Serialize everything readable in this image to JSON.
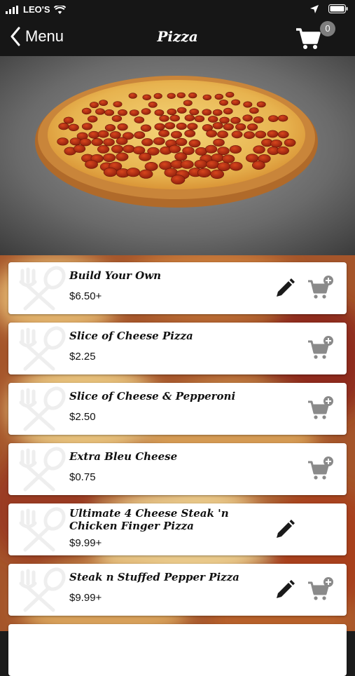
{
  "status_bar": {
    "carrier": "LEO'S"
  },
  "nav": {
    "back_label": "Menu",
    "title": "Pizza",
    "cart_count": "0"
  },
  "items": [
    {
      "name": "Build Your Own",
      "price": "$6.50+",
      "editable": true,
      "addable": true
    },
    {
      "name": "Slice of Cheese Pizza",
      "price": "$2.25",
      "editable": false,
      "addable": true
    },
    {
      "name": "Slice of Cheese & Pepperoni",
      "price": "$2.50",
      "editable": false,
      "addable": true
    },
    {
      "name": "Extra Bleu Cheese",
      "price": "$0.75",
      "editable": false,
      "addable": true
    },
    {
      "name": "Ultimate 4 Cheese Steak 'n Chicken Finger Pizza",
      "price": "$9.99+",
      "editable": true,
      "addable": false
    },
    {
      "name": "Steak n Stuffed Pepper Pizza",
      "price": "$9.99+",
      "editable": true,
      "addable": true
    }
  ],
  "colors": {
    "bar": "#161616",
    "card": "#ffffff",
    "icon_dark": "#1a1a1a",
    "icon_grey": "#8a8a8a",
    "badge": "#7e7e7e"
  }
}
